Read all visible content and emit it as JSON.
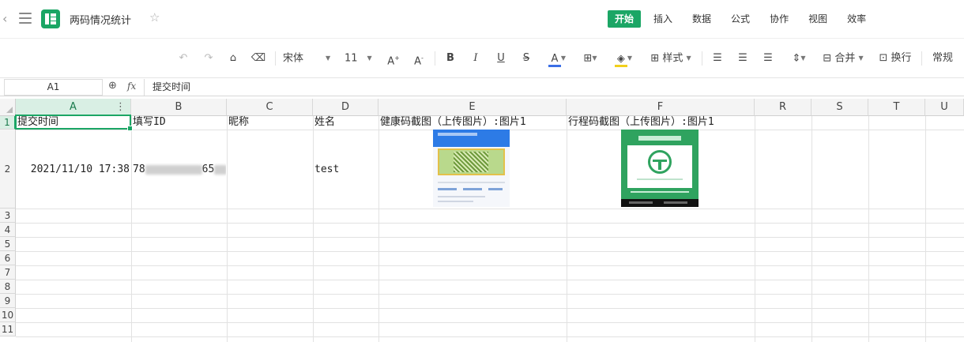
{
  "app": {
    "title": "两码情况统计",
    "menu_tabs": [
      "开始",
      "插入",
      "数据",
      "公式",
      "协作",
      "视图",
      "效率"
    ],
    "active_tab": "开始"
  },
  "toolbar": {
    "font_name": "宋体",
    "font_size": "11",
    "format_label": "样式",
    "merge_label": "合并",
    "wrap_label": "换行",
    "number_format": "常规",
    "font_color": "#3b6fe6",
    "fill_color": "#f2d01c"
  },
  "formula_bar": {
    "cell_ref": "A1",
    "fx": "fx",
    "content": "提交时间"
  },
  "columns": [
    "A",
    "B",
    "C",
    "D",
    "E",
    "F",
    "R",
    "S",
    "T",
    "U"
  ],
  "rows": [
    "1",
    "2",
    "3",
    "4",
    "5",
    "6",
    "7",
    "8",
    "9",
    "10",
    "11"
  ],
  "header_row": [
    "提交时间",
    "填写ID",
    "昵称",
    "姓名",
    "健康码截图（上传图片）:图片1",
    "行程码截图（上传图片）:图片1"
  ],
  "data_row": {
    "time": "2021/11/10 17:38",
    "id_prefix": "78",
    "id_mid": "65",
    "name": "test"
  },
  "colors": {
    "accent": "#1ba665",
    "health_blue": "#2d7be6",
    "trip_green": "#2fa35f"
  }
}
